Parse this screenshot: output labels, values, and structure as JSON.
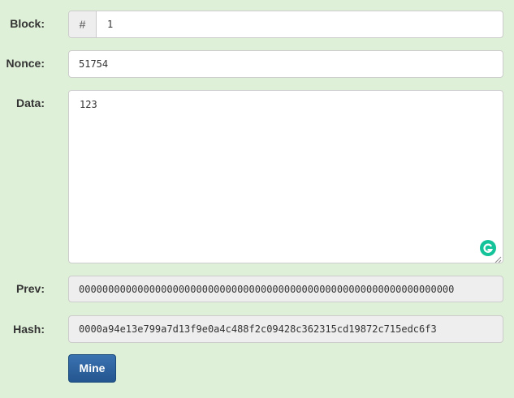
{
  "form": {
    "block": {
      "label": "Block:",
      "prefix": "#",
      "value": "1"
    },
    "nonce": {
      "label": "Nonce:",
      "value": "51754"
    },
    "data": {
      "label": "Data:",
      "value": "123"
    },
    "prev": {
      "label": "Prev:",
      "value": "0000000000000000000000000000000000000000000000000000000000000000"
    },
    "hash": {
      "label": "Hash:",
      "value": "0000a94e13e799a7d13f9e0a4c488f2c09428c362315cd19872c715edc6f3"
    }
  },
  "actions": {
    "mine_label": "Mine"
  },
  "icons": {
    "grammarly": "grammarly-icon",
    "resize": "resize-handle-icon"
  },
  "colors": {
    "background": "#dff0d8",
    "button": "#245690",
    "grammarly": "#15c39a"
  }
}
